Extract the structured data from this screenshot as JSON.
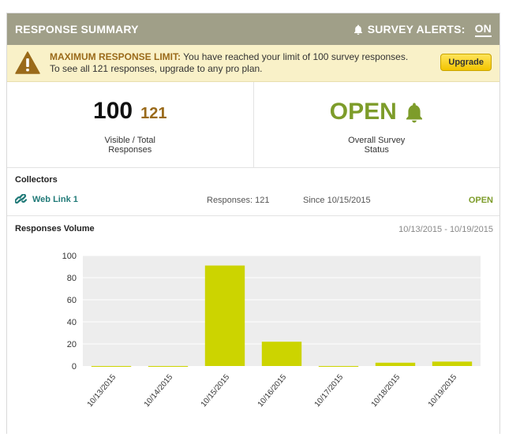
{
  "header": {
    "title": "RESPONSE SUMMARY",
    "alerts_label": "SURVEY ALERTS:",
    "alerts_state": "ON"
  },
  "warning": {
    "title": "MAXIMUM RESPONSE LIMIT:",
    "line1": "You have reached your limit of 100 survey responses.",
    "line2": "To see all 121 responses, upgrade to any pro plan.",
    "button": "Upgrade"
  },
  "stats": {
    "visible": "100",
    "total": "121",
    "responses_label_1": "Visible / Total",
    "responses_label_2": "Responses",
    "status": "OPEN",
    "status_label_1": "Overall Survey",
    "status_label_2": "Status"
  },
  "collectors": {
    "title": "Collectors",
    "items": [
      {
        "name": "Web Link 1",
        "responses": "Responses: 121",
        "since": "Since 10/15/2015",
        "status": "OPEN"
      }
    ]
  },
  "volume": {
    "title": "Responses Volume",
    "range": "10/13/2015 - 10/19/2015"
  },
  "colors": {
    "header": "#a09f88",
    "accent_green": "#7d9c2a",
    "bar": "#ccd400",
    "warn_bg": "#f9f1c8",
    "total_brown": "#9a6a1a"
  },
  "chart_data": {
    "type": "bar",
    "categories": [
      "10/13/2015",
      "10/14/2015",
      "10/15/2015",
      "10/16/2015",
      "10/17/2015",
      "10/18/2015",
      "10/19/2015"
    ],
    "values": [
      0,
      0,
      91,
      22,
      0,
      3,
      4
    ],
    "ylim": [
      0,
      100
    ],
    "yticks": [
      0,
      20,
      40,
      60,
      80,
      100
    ],
    "grid": true
  }
}
